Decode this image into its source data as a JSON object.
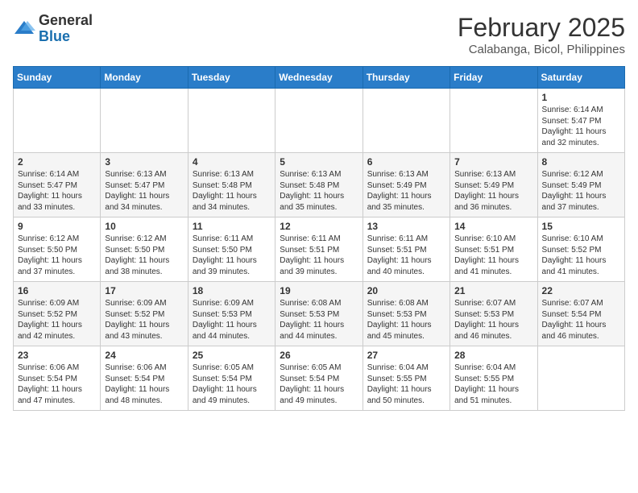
{
  "header": {
    "logo_general": "General",
    "logo_blue": "Blue",
    "month_year": "February 2025",
    "location": "Calabanga, Bicol, Philippines"
  },
  "days_of_week": [
    "Sunday",
    "Monday",
    "Tuesday",
    "Wednesday",
    "Thursday",
    "Friday",
    "Saturday"
  ],
  "weeks": [
    [
      {
        "day": "",
        "info": ""
      },
      {
        "day": "",
        "info": ""
      },
      {
        "day": "",
        "info": ""
      },
      {
        "day": "",
        "info": ""
      },
      {
        "day": "",
        "info": ""
      },
      {
        "day": "",
        "info": ""
      },
      {
        "day": "1",
        "info": "Sunrise: 6:14 AM\nSunset: 5:47 PM\nDaylight: 11 hours\nand 32 minutes."
      }
    ],
    [
      {
        "day": "2",
        "info": "Sunrise: 6:14 AM\nSunset: 5:47 PM\nDaylight: 11 hours\nand 33 minutes."
      },
      {
        "day": "3",
        "info": "Sunrise: 6:13 AM\nSunset: 5:47 PM\nDaylight: 11 hours\nand 34 minutes."
      },
      {
        "day": "4",
        "info": "Sunrise: 6:13 AM\nSunset: 5:48 PM\nDaylight: 11 hours\nand 34 minutes."
      },
      {
        "day": "5",
        "info": "Sunrise: 6:13 AM\nSunset: 5:48 PM\nDaylight: 11 hours\nand 35 minutes."
      },
      {
        "day": "6",
        "info": "Sunrise: 6:13 AM\nSunset: 5:49 PM\nDaylight: 11 hours\nand 35 minutes."
      },
      {
        "day": "7",
        "info": "Sunrise: 6:13 AM\nSunset: 5:49 PM\nDaylight: 11 hours\nand 36 minutes."
      },
      {
        "day": "8",
        "info": "Sunrise: 6:12 AM\nSunset: 5:49 PM\nDaylight: 11 hours\nand 37 minutes."
      }
    ],
    [
      {
        "day": "9",
        "info": "Sunrise: 6:12 AM\nSunset: 5:50 PM\nDaylight: 11 hours\nand 37 minutes."
      },
      {
        "day": "10",
        "info": "Sunrise: 6:12 AM\nSunset: 5:50 PM\nDaylight: 11 hours\nand 38 minutes."
      },
      {
        "day": "11",
        "info": "Sunrise: 6:11 AM\nSunset: 5:50 PM\nDaylight: 11 hours\nand 39 minutes."
      },
      {
        "day": "12",
        "info": "Sunrise: 6:11 AM\nSunset: 5:51 PM\nDaylight: 11 hours\nand 39 minutes."
      },
      {
        "day": "13",
        "info": "Sunrise: 6:11 AM\nSunset: 5:51 PM\nDaylight: 11 hours\nand 40 minutes."
      },
      {
        "day": "14",
        "info": "Sunrise: 6:10 AM\nSunset: 5:51 PM\nDaylight: 11 hours\nand 41 minutes."
      },
      {
        "day": "15",
        "info": "Sunrise: 6:10 AM\nSunset: 5:52 PM\nDaylight: 11 hours\nand 41 minutes."
      }
    ],
    [
      {
        "day": "16",
        "info": "Sunrise: 6:09 AM\nSunset: 5:52 PM\nDaylight: 11 hours\nand 42 minutes."
      },
      {
        "day": "17",
        "info": "Sunrise: 6:09 AM\nSunset: 5:52 PM\nDaylight: 11 hours\nand 43 minutes."
      },
      {
        "day": "18",
        "info": "Sunrise: 6:09 AM\nSunset: 5:53 PM\nDaylight: 11 hours\nand 44 minutes."
      },
      {
        "day": "19",
        "info": "Sunrise: 6:08 AM\nSunset: 5:53 PM\nDaylight: 11 hours\nand 44 minutes."
      },
      {
        "day": "20",
        "info": "Sunrise: 6:08 AM\nSunset: 5:53 PM\nDaylight: 11 hours\nand 45 minutes."
      },
      {
        "day": "21",
        "info": "Sunrise: 6:07 AM\nSunset: 5:53 PM\nDaylight: 11 hours\nand 46 minutes."
      },
      {
        "day": "22",
        "info": "Sunrise: 6:07 AM\nSunset: 5:54 PM\nDaylight: 11 hours\nand 46 minutes."
      }
    ],
    [
      {
        "day": "23",
        "info": "Sunrise: 6:06 AM\nSunset: 5:54 PM\nDaylight: 11 hours\nand 47 minutes."
      },
      {
        "day": "24",
        "info": "Sunrise: 6:06 AM\nSunset: 5:54 PM\nDaylight: 11 hours\nand 48 minutes."
      },
      {
        "day": "25",
        "info": "Sunrise: 6:05 AM\nSunset: 5:54 PM\nDaylight: 11 hours\nand 49 minutes."
      },
      {
        "day": "26",
        "info": "Sunrise: 6:05 AM\nSunset: 5:54 PM\nDaylight: 11 hours\nand 49 minutes."
      },
      {
        "day": "27",
        "info": "Sunrise: 6:04 AM\nSunset: 5:55 PM\nDaylight: 11 hours\nand 50 minutes."
      },
      {
        "day": "28",
        "info": "Sunrise: 6:04 AM\nSunset: 5:55 PM\nDaylight: 11 hours\nand 51 minutes."
      },
      {
        "day": "",
        "info": ""
      }
    ]
  ]
}
